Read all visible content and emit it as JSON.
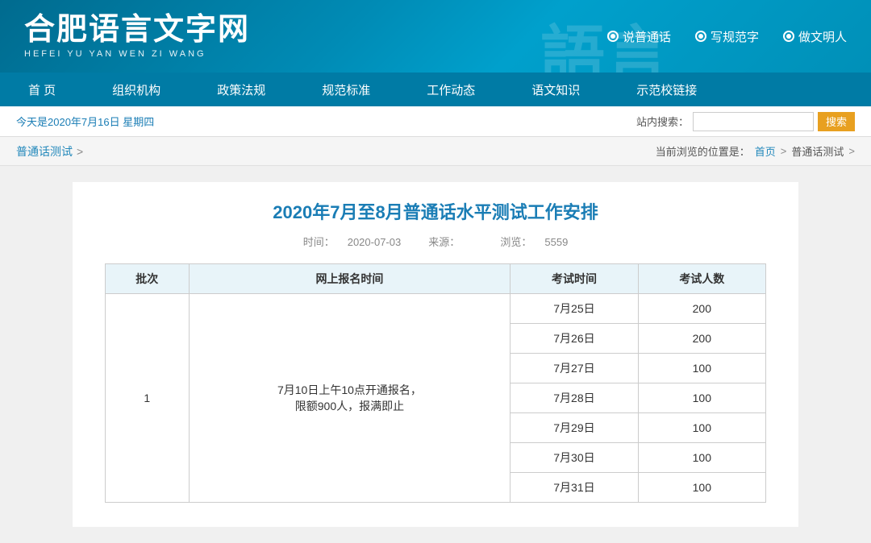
{
  "header": {
    "logo_main": "合肥语言文字网",
    "logo_sub": "HEFEI YU YAN WEN ZI WANG",
    "slogans": [
      "说普通话",
      "写规范字",
      "做文明人"
    ],
    "bg_text": "語"
  },
  "nav": {
    "items": [
      "首 页",
      "组织机构",
      "政策法规",
      "规范标准",
      "工作动态",
      "语文知识",
      "示范校链接"
    ]
  },
  "toolbar": {
    "date_text": "今天是2020年7月16日   星期四",
    "search_label": "站内搜索：",
    "search_placeholder": "",
    "search_button": "搜索"
  },
  "breadcrumb": {
    "left_label": "普通话测试",
    "location_label": "当前浏览的位置是：",
    "home": "首页",
    "current": "普通话测试"
  },
  "article": {
    "title": "2020年7月至8月普通话水平测试工作安排",
    "time_label": "时间：",
    "time_value": "2020-07-03",
    "source_label": "来源：",
    "source_value": "",
    "views_label": "浏览：",
    "views_value": "5559"
  },
  "table": {
    "headers": [
      "批次",
      "网上报名时间",
      "考试时间",
      "考试人数"
    ],
    "rows": [
      {
        "batch": "1",
        "registration": "7月10日上午10点开通报名，\n限额900人，报满即止",
        "exam_date": "7月25日",
        "count": "200"
      },
      {
        "batch": "",
        "registration": "",
        "exam_date": "7月26日",
        "count": "200"
      },
      {
        "batch": "",
        "registration": "",
        "exam_date": "7月27日",
        "count": "100"
      },
      {
        "batch": "",
        "registration": "",
        "exam_date": "7月28日",
        "count": "100"
      },
      {
        "batch": "",
        "registration": "",
        "exam_date": "7月29日",
        "count": "100"
      },
      {
        "batch": "",
        "registration": "",
        "exam_date": "7月30日",
        "count": "100"
      },
      {
        "batch": "",
        "registration": "",
        "exam_date": "7月31日",
        "count": "100"
      }
    ]
  },
  "icons": {
    "search": "🔍",
    "chevron_right": ">"
  }
}
